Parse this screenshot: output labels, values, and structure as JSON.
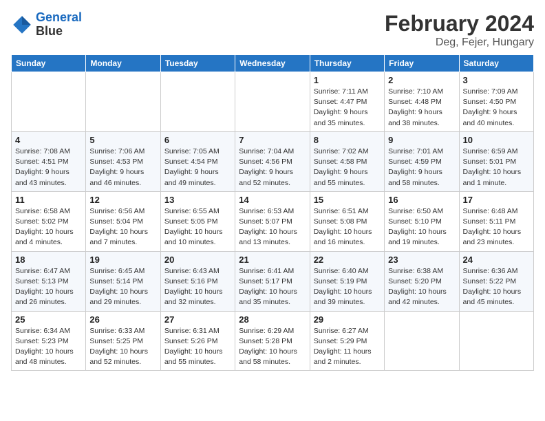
{
  "logo": {
    "line1": "General",
    "line2": "Blue"
  },
  "title": "February 2024",
  "location": "Deg, Fejer, Hungary",
  "weekdays": [
    "Sunday",
    "Monday",
    "Tuesday",
    "Wednesday",
    "Thursday",
    "Friday",
    "Saturday"
  ],
  "weeks": [
    [
      {
        "day": "",
        "info": ""
      },
      {
        "day": "",
        "info": ""
      },
      {
        "day": "",
        "info": ""
      },
      {
        "day": "",
        "info": ""
      },
      {
        "day": "1",
        "info": "Sunrise: 7:11 AM\nSunset: 4:47 PM\nDaylight: 9 hours\nand 35 minutes."
      },
      {
        "day": "2",
        "info": "Sunrise: 7:10 AM\nSunset: 4:48 PM\nDaylight: 9 hours\nand 38 minutes."
      },
      {
        "day": "3",
        "info": "Sunrise: 7:09 AM\nSunset: 4:50 PM\nDaylight: 9 hours\nand 40 minutes."
      }
    ],
    [
      {
        "day": "4",
        "info": "Sunrise: 7:08 AM\nSunset: 4:51 PM\nDaylight: 9 hours\nand 43 minutes."
      },
      {
        "day": "5",
        "info": "Sunrise: 7:06 AM\nSunset: 4:53 PM\nDaylight: 9 hours\nand 46 minutes."
      },
      {
        "day": "6",
        "info": "Sunrise: 7:05 AM\nSunset: 4:54 PM\nDaylight: 9 hours\nand 49 minutes."
      },
      {
        "day": "7",
        "info": "Sunrise: 7:04 AM\nSunset: 4:56 PM\nDaylight: 9 hours\nand 52 minutes."
      },
      {
        "day": "8",
        "info": "Sunrise: 7:02 AM\nSunset: 4:58 PM\nDaylight: 9 hours\nand 55 minutes."
      },
      {
        "day": "9",
        "info": "Sunrise: 7:01 AM\nSunset: 4:59 PM\nDaylight: 9 hours\nand 58 minutes."
      },
      {
        "day": "10",
        "info": "Sunrise: 6:59 AM\nSunset: 5:01 PM\nDaylight: 10 hours\nand 1 minute."
      }
    ],
    [
      {
        "day": "11",
        "info": "Sunrise: 6:58 AM\nSunset: 5:02 PM\nDaylight: 10 hours\nand 4 minutes."
      },
      {
        "day": "12",
        "info": "Sunrise: 6:56 AM\nSunset: 5:04 PM\nDaylight: 10 hours\nand 7 minutes."
      },
      {
        "day": "13",
        "info": "Sunrise: 6:55 AM\nSunset: 5:05 PM\nDaylight: 10 hours\nand 10 minutes."
      },
      {
        "day": "14",
        "info": "Sunrise: 6:53 AM\nSunset: 5:07 PM\nDaylight: 10 hours\nand 13 minutes."
      },
      {
        "day": "15",
        "info": "Sunrise: 6:51 AM\nSunset: 5:08 PM\nDaylight: 10 hours\nand 16 minutes."
      },
      {
        "day": "16",
        "info": "Sunrise: 6:50 AM\nSunset: 5:10 PM\nDaylight: 10 hours\nand 19 minutes."
      },
      {
        "day": "17",
        "info": "Sunrise: 6:48 AM\nSunset: 5:11 PM\nDaylight: 10 hours\nand 23 minutes."
      }
    ],
    [
      {
        "day": "18",
        "info": "Sunrise: 6:47 AM\nSunset: 5:13 PM\nDaylight: 10 hours\nand 26 minutes."
      },
      {
        "day": "19",
        "info": "Sunrise: 6:45 AM\nSunset: 5:14 PM\nDaylight: 10 hours\nand 29 minutes."
      },
      {
        "day": "20",
        "info": "Sunrise: 6:43 AM\nSunset: 5:16 PM\nDaylight: 10 hours\nand 32 minutes."
      },
      {
        "day": "21",
        "info": "Sunrise: 6:41 AM\nSunset: 5:17 PM\nDaylight: 10 hours\nand 35 minutes."
      },
      {
        "day": "22",
        "info": "Sunrise: 6:40 AM\nSunset: 5:19 PM\nDaylight: 10 hours\nand 39 minutes."
      },
      {
        "day": "23",
        "info": "Sunrise: 6:38 AM\nSunset: 5:20 PM\nDaylight: 10 hours\nand 42 minutes."
      },
      {
        "day": "24",
        "info": "Sunrise: 6:36 AM\nSunset: 5:22 PM\nDaylight: 10 hours\nand 45 minutes."
      }
    ],
    [
      {
        "day": "25",
        "info": "Sunrise: 6:34 AM\nSunset: 5:23 PM\nDaylight: 10 hours\nand 48 minutes."
      },
      {
        "day": "26",
        "info": "Sunrise: 6:33 AM\nSunset: 5:25 PM\nDaylight: 10 hours\nand 52 minutes."
      },
      {
        "day": "27",
        "info": "Sunrise: 6:31 AM\nSunset: 5:26 PM\nDaylight: 10 hours\nand 55 minutes."
      },
      {
        "day": "28",
        "info": "Sunrise: 6:29 AM\nSunset: 5:28 PM\nDaylight: 10 hours\nand 58 minutes."
      },
      {
        "day": "29",
        "info": "Sunrise: 6:27 AM\nSunset: 5:29 PM\nDaylight: 11 hours\nand 2 minutes."
      },
      {
        "day": "",
        "info": ""
      },
      {
        "day": "",
        "info": ""
      }
    ]
  ]
}
